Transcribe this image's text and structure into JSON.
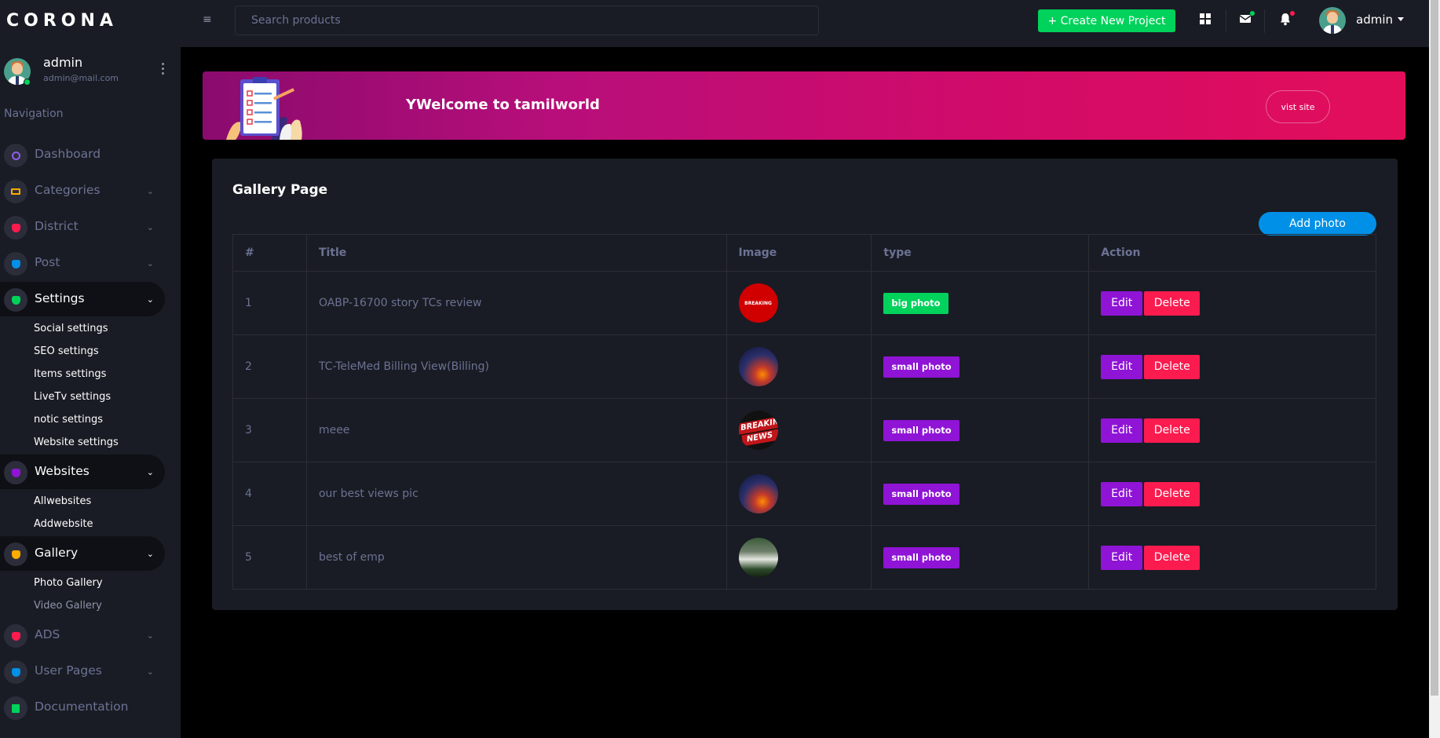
{
  "brand": "CORONA",
  "profile": {
    "name": "admin",
    "email": "admin@mail.com"
  },
  "nav_heading": "Navigation",
  "nav": [
    {
      "label": "Dashboard",
      "color": "#8f5fe8"
    },
    {
      "label": "Categories",
      "color": "#ffab00"
    },
    {
      "label": "District",
      "color": "#fc1b4f"
    },
    {
      "label": "Post",
      "color": "#0090e7"
    },
    {
      "label": "Settings",
      "color": "#00d25b"
    },
    {
      "label": "Websites",
      "color": "#8f14d6"
    },
    {
      "label": "Gallery",
      "color": "#ffab00"
    },
    {
      "label": "ADS",
      "color": "#fc1b4f"
    },
    {
      "label": "User Pages",
      "color": "#0090e7"
    },
    {
      "label": "Documentation",
      "color": "#00d25b"
    }
  ],
  "settings_sub": [
    "Social settings",
    "SEO settings",
    "Items settings",
    "LiveTv settings",
    "notic settings",
    "Website settings"
  ],
  "websites_sub": [
    "Allwebsites",
    "Addwebsite"
  ],
  "gallery_sub": [
    "Photo Gallery",
    "Video Gallery"
  ],
  "topbar": {
    "search_placeholder": "Search products",
    "create_label": "+ Create New Project",
    "user": "admin"
  },
  "banner": {
    "text": "YWelcome to tamilworld",
    "button": "vist site"
  },
  "card": {
    "title": "Gallery Page",
    "add_label": "Add photo",
    "headers": [
      "#",
      "Title",
      "Image",
      "type",
      "Action"
    ],
    "rows": [
      {
        "num": "1",
        "title": "OABP-16700 story TCs review",
        "image": "breaking-red",
        "type": "big photo"
      },
      {
        "num": "2",
        "title": "TC-TeleMed Billing View(Billing)",
        "image": "sunset",
        "type": "small photo"
      },
      {
        "num": "3",
        "title": "meee",
        "image": "breaking-news",
        "type": "small photo"
      },
      {
        "num": "4",
        "title": "our best views pic",
        "image": "sunset",
        "type": "small photo"
      },
      {
        "num": "5",
        "title": "best of emp",
        "image": "group",
        "type": "small photo"
      }
    ],
    "edit_label": "Edit",
    "delete_label": "Delete",
    "thumb_breaking_text": "BREAKING",
    "thumb_news_1": "BREAKING",
    "thumb_news_2": "NEWS"
  }
}
